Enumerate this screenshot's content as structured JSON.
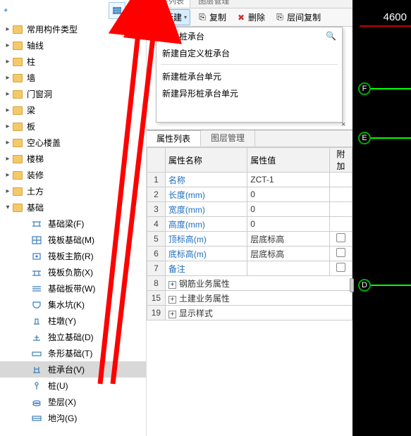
{
  "top_tabs": {
    "list": "构件列表",
    "layer": "图层管理"
  },
  "toolbar": {
    "new": "新建",
    "copy": "复制",
    "delete": "删除",
    "layer_copy": "层间复制"
  },
  "dropdown": {
    "items": [
      "新建桩承台",
      "新建自定义桩承台",
      "新建桩承台单元",
      "新建异形桩承台单元"
    ]
  },
  "tree": {
    "top_folders": [
      "常用构件类型",
      "轴线",
      "柱",
      "墙",
      "门窗洞",
      "梁",
      "板",
      "空心楼盖",
      "楼梯",
      "装修",
      "土方"
    ],
    "basic": "基础",
    "children": [
      {
        "label": "基础梁(F)"
      },
      {
        "label": "筏板基础(M)"
      },
      {
        "label": "筏板主筋(R)"
      },
      {
        "label": "筏板负筋(X)"
      },
      {
        "label": "基础板带(W)"
      },
      {
        "label": "集水坑(K)"
      },
      {
        "label": "柱墩(Y)"
      },
      {
        "label": "独立基础(D)"
      },
      {
        "label": "条形基础(T)"
      },
      {
        "label": "桩承台(V)",
        "selected": true
      },
      {
        "label": "桩(U)"
      },
      {
        "label": "垫层(X)"
      },
      {
        "label": "地沟(G)"
      }
    ]
  },
  "properties": {
    "tabs": {
      "attr": "属性列表",
      "layer": "图层管理"
    },
    "headers": {
      "name": "属性名称",
      "value": "属性值",
      "extra": "附加"
    },
    "rows": [
      {
        "n": "1",
        "name": "名称",
        "value": "ZCT-1",
        "chk": false
      },
      {
        "n": "2",
        "name": "长度(mm)",
        "value": "0",
        "chk": false
      },
      {
        "n": "3",
        "name": "宽度(mm)",
        "value": "0",
        "chk": false
      },
      {
        "n": "4",
        "name": "高度(mm)",
        "value": "0",
        "chk": false
      },
      {
        "n": "5",
        "name": "顶标高(m)",
        "value": "层底标高",
        "chk": true
      },
      {
        "n": "6",
        "name": "底标高(m)",
        "value": "层底标高",
        "chk": true
      },
      {
        "n": "7",
        "name": "备注",
        "value": "",
        "chk": true
      }
    ],
    "groups": [
      {
        "n": "8",
        "name": "钢筋业务属性"
      },
      {
        "n": "15",
        "name": "土建业务属性"
      },
      {
        "n": "19",
        "name": "显示样式"
      }
    ]
  },
  "viewport": {
    "number": "4600",
    "nodes": [
      "F",
      "E",
      "D"
    ]
  }
}
